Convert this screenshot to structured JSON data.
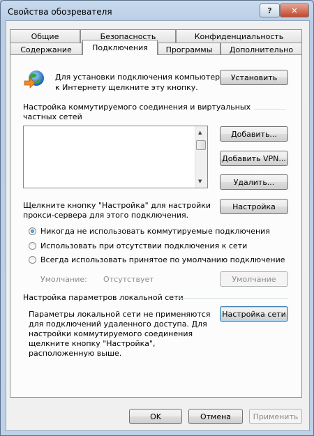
{
  "window": {
    "title": "Свойства обозревателя"
  },
  "tabs_top": [
    "Общие",
    "Безопасность",
    "Конфиденциальность"
  ],
  "tabs_bottom": [
    "Содержание",
    "Подключения",
    "Программы",
    "Дополнительно"
  ],
  "setup": {
    "text1": "Для установки подключения компьютера",
    "text2": "к Интернету щелкните эту кнопку.",
    "button": "Установить"
  },
  "dialup": {
    "heading1": "Настройка коммутируемого соединения и виртуальных",
    "heading2": "частных сетей"
  },
  "dialup_buttons": {
    "add": "Добавить...",
    "add_vpn": "Добавить VPN...",
    "remove": "Удалить...",
    "settings": "Настройка"
  },
  "proxy": {
    "text1": "Щелкните кнопку \"Настройка\" для настройки",
    "text2": "прокси-сервера для этого подключения."
  },
  "radios": [
    {
      "label": "Никогда не использовать коммутируемые подключения",
      "checked": true
    },
    {
      "label": "Использовать при отсутствии подключения к сети",
      "checked": false
    },
    {
      "label": "Всегда использовать принятое по умолчанию подключение",
      "checked": false
    }
  ],
  "default": {
    "label": "Умолчание:",
    "value": "Отсутствует",
    "button": "Умолчание"
  },
  "lan": {
    "heading": "Настройка параметров локальной сети",
    "text": [
      "Параметры локальной сети не применяются",
      "для подключений удаленного доступа. Для",
      "настройки коммутируемого соединения",
      "щелкните кнопку \"Настройка\",",
      "расположенную выше."
    ],
    "button": "Настройка сети"
  },
  "footer": {
    "ok": "OK",
    "cancel": "Отмена",
    "apply": "Применить"
  }
}
